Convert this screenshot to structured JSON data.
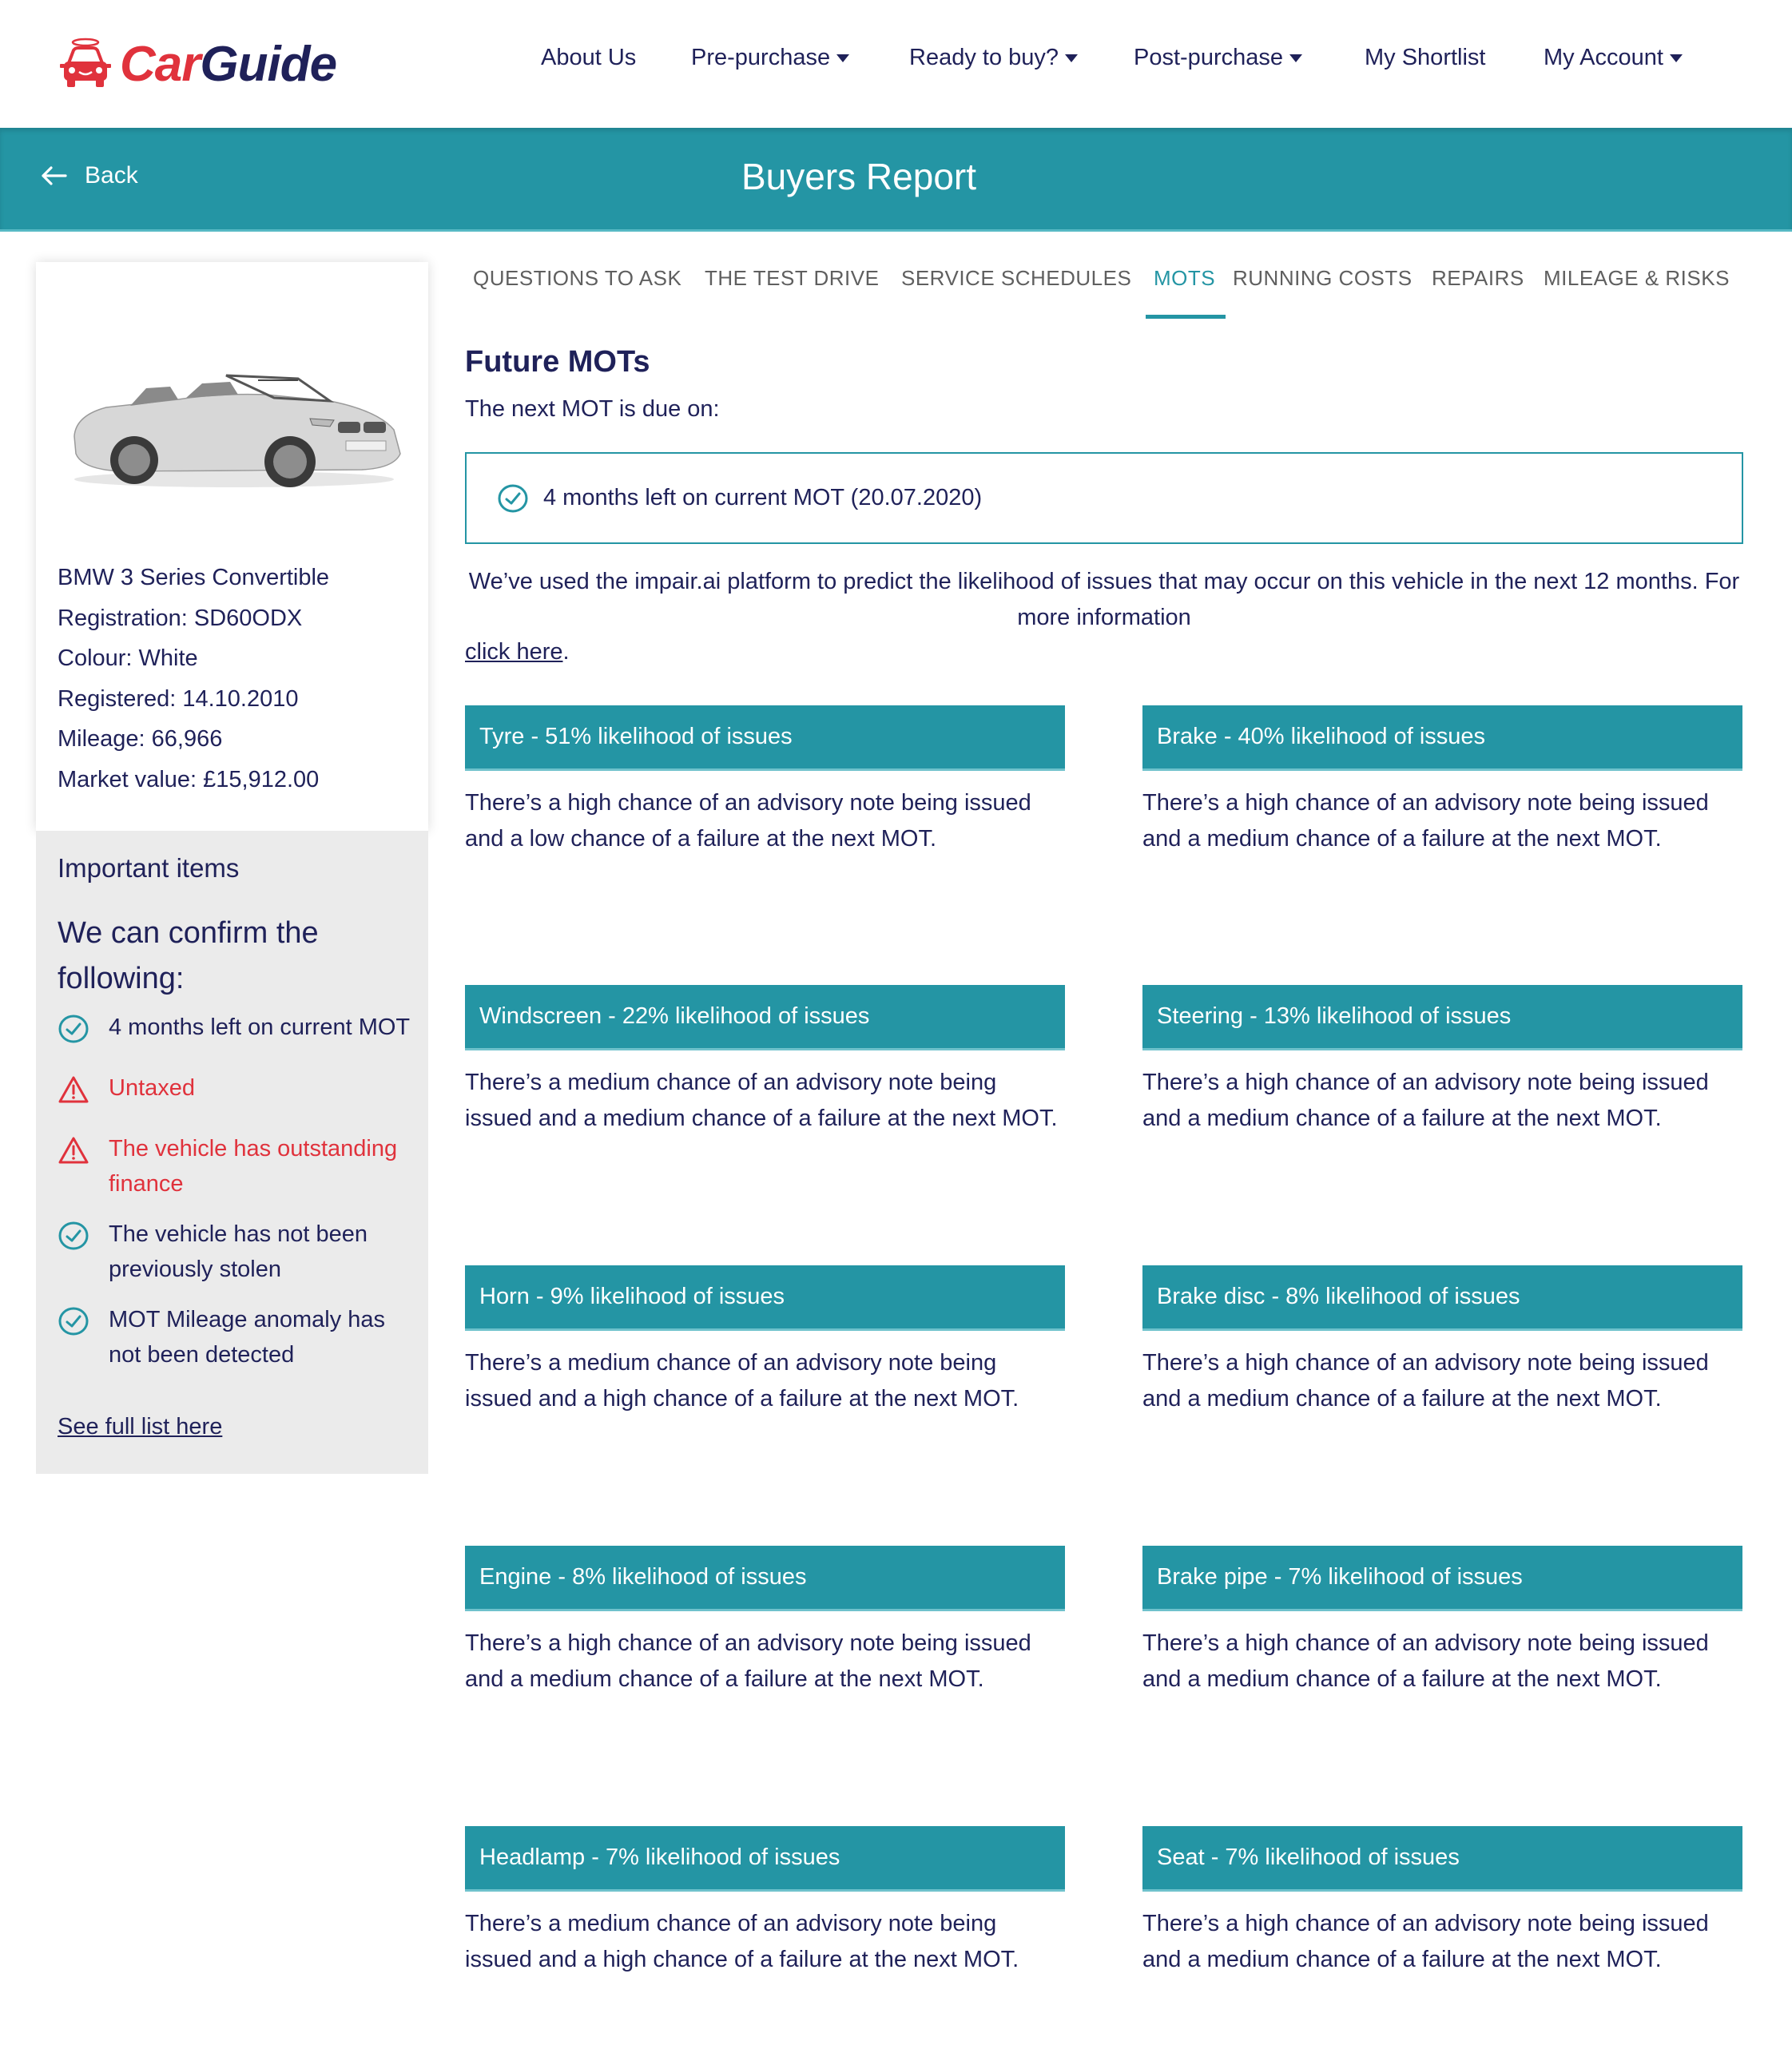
{
  "brand": {
    "name_part1": "Car",
    "name_part2": "Guide",
    "logo_icon": "halo-car-icon",
    "colors": {
      "red": "#e0323c",
      "navy": "#1f2159",
      "teal": "#2495a4"
    }
  },
  "nav": {
    "items": [
      {
        "label": "About Us",
        "dropdown": false
      },
      {
        "label": "Pre-purchase",
        "dropdown": true
      },
      {
        "label": "Ready to buy?",
        "dropdown": true
      },
      {
        "label": "Post-purchase",
        "dropdown": true
      },
      {
        "label": "My Shortlist",
        "dropdown": false
      },
      {
        "label": "My Account",
        "dropdown": true
      }
    ]
  },
  "titlebar": {
    "back_label": "Back",
    "title": "Buyers Report"
  },
  "vehicle": {
    "image_alt": "White BMW 3 Series Convertible",
    "lines": [
      "BMW 3 Series Convertible",
      "Registration: SD60ODX",
      "Colour: White",
      "Registered: 14.10.2010",
      "Mileage: 66,966",
      "Market value: £15,912.00"
    ]
  },
  "important": {
    "title": "Important items",
    "subtitle": "We can confirm the following:",
    "items": [
      {
        "status": "ok",
        "icon": "check-circle-icon",
        "text": "4 months left on current MOT"
      },
      {
        "status": "warn",
        "icon": "warning-triangle-icon",
        "text": "Untaxed"
      },
      {
        "status": "warn",
        "icon": "warning-triangle-icon",
        "text": "The vehicle has outstanding finance"
      },
      {
        "status": "ok",
        "icon": "check-circle-icon",
        "text": "The vehicle has not been previously stolen"
      },
      {
        "status": "ok",
        "icon": "check-circle-icon",
        "text": "MOT Mileage anomaly has not been detected"
      }
    ],
    "see_full_label": "See full list here"
  },
  "tabs": {
    "items": [
      "QUESTIONS TO ASK",
      "THE TEST DRIVE",
      "SERVICE SCHEDULES",
      "MOTS",
      "RUNNING COSTS",
      "REPAIRS",
      "MILEAGE & RISKS"
    ],
    "active": "MOTS"
  },
  "mot": {
    "heading": "Future MOTs",
    "due_intro": "The next MOT is due on:",
    "status_text": "4 months left on current MOT (20.07.2020)",
    "impair_text": "We’ve used the impair.ai platform to predict the likelihood of issues that may occur on this vehicle in the next 12 months. For more information",
    "click_here_label": "click here",
    "click_here_suffix": "."
  },
  "issues": [
    {
      "title": "Tyre - 51% likelihood of issues",
      "component": "Tyre",
      "likelihood_pct": 51,
      "text": "There’s a high chance of an advisory note being issued and a low chance of a failure at the next MOT."
    },
    {
      "title": "Brake - 40% likelihood of issues",
      "component": "Brake",
      "likelihood_pct": 40,
      "text": "There’s a high chance of an advisory note being issued and a medium chance of a failure at the next MOT."
    },
    {
      "title": "Windscreen - 22% likelihood of issues",
      "component": "Windscreen",
      "likelihood_pct": 22,
      "text": "There’s a medium chance of an advisory note being issued and a medium chance of a failure at the next MOT."
    },
    {
      "title": "Steering - 13% likelihood of issues",
      "component": "Steering",
      "likelihood_pct": 13,
      "text": "There’s a high chance of an advisory note being issued and a medium chance of a failure at the next MOT."
    },
    {
      "title": "Horn - 9% likelihood of issues",
      "component": "Horn",
      "likelihood_pct": 9,
      "text": "There’s a medium chance of an advisory note being issued and a high chance of a failure at the next MOT."
    },
    {
      "title": "Brake disc - 8% likelihood of issues",
      "component": "Brake disc",
      "likelihood_pct": 8,
      "text": "There’s a high chance of an advisory note being issued and a medium chance of a failure at the next MOT."
    },
    {
      "title": "Engine - 8% likelihood of issues",
      "component": "Engine",
      "likelihood_pct": 8,
      "text": "There’s a high chance of an advisory note being issued and a medium chance of a failure at the next MOT."
    },
    {
      "title": "Brake pipe - 7% likelihood of issues",
      "component": "Brake pipe",
      "likelihood_pct": 7,
      "text": "There’s a high chance of an advisory note being issued and a medium chance of a failure at the next MOT."
    },
    {
      "title": "Headlamp - 7% likelihood of issues",
      "component": "Headlamp",
      "likelihood_pct": 7,
      "text": "There’s a medium chance of an advisory note being issued and a high chance of a failure at the next MOT."
    },
    {
      "title": "Seat - 7% likelihood of issues",
      "component": "Seat",
      "likelihood_pct": 7,
      "text": "There’s a high chance of an advisory note being issued and a medium chance of a failure at the next MOT."
    }
  ]
}
